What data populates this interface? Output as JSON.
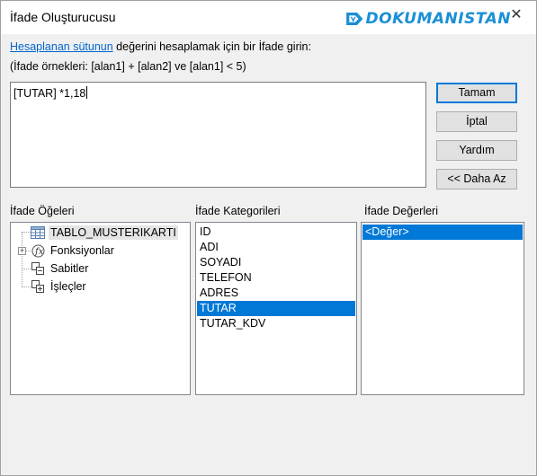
{
  "window": {
    "title": "İfade Oluşturucusu",
    "close_glyph": "✕"
  },
  "watermark": {
    "text": "DOKUMANISTAN"
  },
  "intro": {
    "link_text": "Hesaplanan sütunun",
    "rest_text": " değerini hesaplamak için bir İfade girin:",
    "examples_text": "(İfade örnekleri: [alan1] + [alan2] ve [alan1] < 5)"
  },
  "expression": {
    "value": "[TUTAR] *1,18"
  },
  "buttons": {
    "ok": "Tamam",
    "cancel": "İptal",
    "help": "Yardım",
    "less": "<< Daha Az"
  },
  "panels": {
    "elements_label": "İfade Öğeleri",
    "categories_label": "İfade Kategorileri",
    "values_label": "İfade Değerleri"
  },
  "elements_tree": [
    {
      "label": "TABLO_MUSTERIKARTI",
      "icon": "table-icon",
      "selected": true
    },
    {
      "label": "Fonksiyonlar",
      "icon": "function-icon",
      "expandable": true
    },
    {
      "label": "Sabitler",
      "icon": "constants-icon"
    },
    {
      "label": "İşleçler",
      "icon": "operators-icon"
    }
  ],
  "categories": [
    "ID",
    "ADI",
    "SOYADI",
    "TELEFON",
    "ADRES",
    "TUTAR",
    "TUTAR_KDV"
  ],
  "categories_selected": "TUTAR",
  "values": [
    "<Değer>"
  ],
  "values_selected": "<Değer>",
  "colors": {
    "accent": "#0078d7",
    "link": "#0066cc",
    "watermark": "#1b8fd6"
  }
}
